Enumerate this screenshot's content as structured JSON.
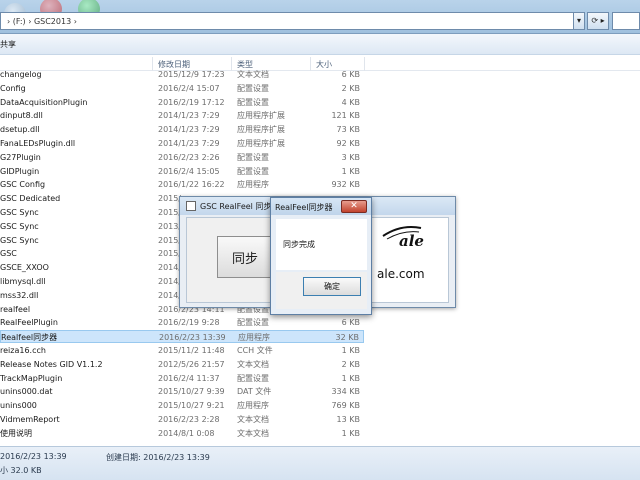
{
  "address_bar": {
    "path": "› (F:) › GSC2013 ›",
    "dropdown_icon": "chevron-down-icon",
    "refresh_icon": "refresh-icon"
  },
  "toolbar": {
    "share_label": "共享"
  },
  "columns": {
    "date": "修改日期",
    "type": "类型",
    "size": "大小"
  },
  "files": [
    {
      "name": "changelog",
      "date": "2015/12/9 17:23",
      "type": "文本文档",
      "size": "6 KB"
    },
    {
      "name": "Config",
      "date": "2016/2/4 15:07",
      "type": "配置设置",
      "size": "2 KB"
    },
    {
      "name": "DataAcquisitionPlugin",
      "date": "2016/2/19 17:12",
      "type": "配置设置",
      "size": "4 KB"
    },
    {
      "name": "dinput8.dll",
      "date": "2014/1/23 7:29",
      "type": "应用程序扩展",
      "size": "121 KB"
    },
    {
      "name": "dsetup.dll",
      "date": "2014/1/23 7:29",
      "type": "应用程序扩展",
      "size": "73 KB"
    },
    {
      "name": "FanaLEDsPlugin.dll",
      "date": "2014/1/23 7:29",
      "type": "应用程序扩展",
      "size": "92 KB"
    },
    {
      "name": "G27Plugin",
      "date": "2016/2/23 2:26",
      "type": "配置设置",
      "size": "3 KB"
    },
    {
      "name": "GIDPlugin",
      "date": "2016/2/4 15:05",
      "type": "配置设置",
      "size": "1 KB"
    },
    {
      "name": "GSC Config",
      "date": "2016/1/22 16:22",
      "type": "应用程序",
      "size": "932 KB"
    },
    {
      "name": "GSC Dedicated",
      "date": "2015/",
      "type": "",
      "size": ""
    },
    {
      "name": "GSC Sync",
      "date": "2015/",
      "type": "",
      "size": ""
    },
    {
      "name": "GSC Sync",
      "date": "2013/",
      "type": "",
      "size": ""
    },
    {
      "name": "GSC Sync",
      "date": "2015/",
      "type": "",
      "size": ""
    },
    {
      "name": "GSC",
      "date": "2015/",
      "type": "",
      "size": ""
    },
    {
      "name": "GSCE_XXOO",
      "date": "2014/",
      "type": "",
      "size": ""
    },
    {
      "name": "libmysql.dll",
      "date": "2014/",
      "type": "",
      "size": ""
    },
    {
      "name": "mss32.dll",
      "date": "2014/",
      "type": "",
      "size": ""
    },
    {
      "name": "realfeel",
      "date": "2016/2/23 14:11",
      "type": "配置设置",
      "size": "1 KB"
    },
    {
      "name": "RealFeelPlugin",
      "date": "2016/2/19 9:28",
      "type": "配置设置",
      "size": "6 KB"
    },
    {
      "name": "Realfeel同步器",
      "date": "2016/2/23 13:39",
      "type": "应用程序",
      "size": "32 KB",
      "selected": true
    },
    {
      "name": "reiza16.cch",
      "date": "2015/11/2 11:48",
      "type": "CCH 文件",
      "size": "1 KB"
    },
    {
      "name": "Release Notes GID V1.1.2",
      "date": "2012/5/26 21:57",
      "type": "文本文档",
      "size": "2 KB"
    },
    {
      "name": "TrackMapPlugin",
      "date": "2016/2/4 11:37",
      "type": "配置设置",
      "size": "1 KB"
    },
    {
      "name": "unins000.dat",
      "date": "2015/10/27 9:39",
      "type": "DAT 文件",
      "size": "334 KB"
    },
    {
      "name": "unins000",
      "date": "2015/10/27 9:21",
      "type": "应用程序",
      "size": "769 KB"
    },
    {
      "name": "VidmemReport",
      "date": "2016/2/23 2:28",
      "type": "文本文档",
      "size": "13 KB"
    },
    {
      "name": "使用说明",
      "date": "2014/8/1 0:08",
      "type": "文本文档",
      "size": "1 KB"
    }
  ],
  "details": {
    "modified": "2016/2/23 13:39",
    "created": "创建日期: 2016/2/23 13:39",
    "size": "小 32.0 KB"
  },
  "app_window": {
    "title": "GSC RealFeel 同步",
    "sync_button": "同步",
    "logo_script": "ale",
    "logo_domain": "ale.com"
  },
  "dialog": {
    "title": "RealFeel同步器",
    "close_symbol": "✕",
    "message": "同步完成",
    "ok_label": "确定"
  }
}
